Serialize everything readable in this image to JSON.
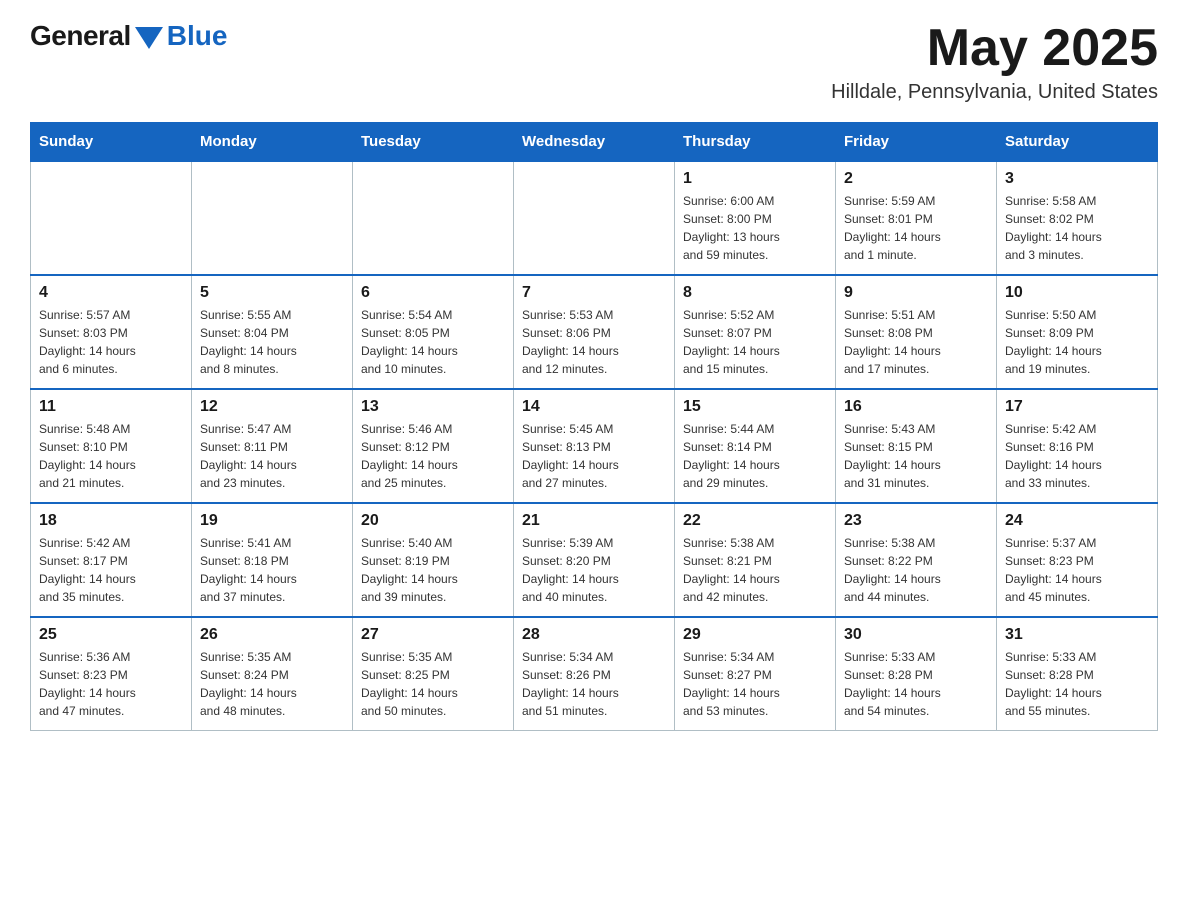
{
  "header": {
    "logo_general": "General",
    "logo_blue": "Blue",
    "month_title": "May 2025",
    "location": "Hilldale, Pennsylvania, United States"
  },
  "calendar": {
    "days_of_week": [
      "Sunday",
      "Monday",
      "Tuesday",
      "Wednesday",
      "Thursday",
      "Friday",
      "Saturday"
    ],
    "weeks": [
      [
        {
          "day": "",
          "info": ""
        },
        {
          "day": "",
          "info": ""
        },
        {
          "day": "",
          "info": ""
        },
        {
          "day": "",
          "info": ""
        },
        {
          "day": "1",
          "info": "Sunrise: 6:00 AM\nSunset: 8:00 PM\nDaylight: 13 hours\nand 59 minutes."
        },
        {
          "day": "2",
          "info": "Sunrise: 5:59 AM\nSunset: 8:01 PM\nDaylight: 14 hours\nand 1 minute."
        },
        {
          "day": "3",
          "info": "Sunrise: 5:58 AM\nSunset: 8:02 PM\nDaylight: 14 hours\nand 3 minutes."
        }
      ],
      [
        {
          "day": "4",
          "info": "Sunrise: 5:57 AM\nSunset: 8:03 PM\nDaylight: 14 hours\nand 6 minutes."
        },
        {
          "day": "5",
          "info": "Sunrise: 5:55 AM\nSunset: 8:04 PM\nDaylight: 14 hours\nand 8 minutes."
        },
        {
          "day": "6",
          "info": "Sunrise: 5:54 AM\nSunset: 8:05 PM\nDaylight: 14 hours\nand 10 minutes."
        },
        {
          "day": "7",
          "info": "Sunrise: 5:53 AM\nSunset: 8:06 PM\nDaylight: 14 hours\nand 12 minutes."
        },
        {
          "day": "8",
          "info": "Sunrise: 5:52 AM\nSunset: 8:07 PM\nDaylight: 14 hours\nand 15 minutes."
        },
        {
          "day": "9",
          "info": "Sunrise: 5:51 AM\nSunset: 8:08 PM\nDaylight: 14 hours\nand 17 minutes."
        },
        {
          "day": "10",
          "info": "Sunrise: 5:50 AM\nSunset: 8:09 PM\nDaylight: 14 hours\nand 19 minutes."
        }
      ],
      [
        {
          "day": "11",
          "info": "Sunrise: 5:48 AM\nSunset: 8:10 PM\nDaylight: 14 hours\nand 21 minutes."
        },
        {
          "day": "12",
          "info": "Sunrise: 5:47 AM\nSunset: 8:11 PM\nDaylight: 14 hours\nand 23 minutes."
        },
        {
          "day": "13",
          "info": "Sunrise: 5:46 AM\nSunset: 8:12 PM\nDaylight: 14 hours\nand 25 minutes."
        },
        {
          "day": "14",
          "info": "Sunrise: 5:45 AM\nSunset: 8:13 PM\nDaylight: 14 hours\nand 27 minutes."
        },
        {
          "day": "15",
          "info": "Sunrise: 5:44 AM\nSunset: 8:14 PM\nDaylight: 14 hours\nand 29 minutes."
        },
        {
          "day": "16",
          "info": "Sunrise: 5:43 AM\nSunset: 8:15 PM\nDaylight: 14 hours\nand 31 minutes."
        },
        {
          "day": "17",
          "info": "Sunrise: 5:42 AM\nSunset: 8:16 PM\nDaylight: 14 hours\nand 33 minutes."
        }
      ],
      [
        {
          "day": "18",
          "info": "Sunrise: 5:42 AM\nSunset: 8:17 PM\nDaylight: 14 hours\nand 35 minutes."
        },
        {
          "day": "19",
          "info": "Sunrise: 5:41 AM\nSunset: 8:18 PM\nDaylight: 14 hours\nand 37 minutes."
        },
        {
          "day": "20",
          "info": "Sunrise: 5:40 AM\nSunset: 8:19 PM\nDaylight: 14 hours\nand 39 minutes."
        },
        {
          "day": "21",
          "info": "Sunrise: 5:39 AM\nSunset: 8:20 PM\nDaylight: 14 hours\nand 40 minutes."
        },
        {
          "day": "22",
          "info": "Sunrise: 5:38 AM\nSunset: 8:21 PM\nDaylight: 14 hours\nand 42 minutes."
        },
        {
          "day": "23",
          "info": "Sunrise: 5:38 AM\nSunset: 8:22 PM\nDaylight: 14 hours\nand 44 minutes."
        },
        {
          "day": "24",
          "info": "Sunrise: 5:37 AM\nSunset: 8:23 PM\nDaylight: 14 hours\nand 45 minutes."
        }
      ],
      [
        {
          "day": "25",
          "info": "Sunrise: 5:36 AM\nSunset: 8:23 PM\nDaylight: 14 hours\nand 47 minutes."
        },
        {
          "day": "26",
          "info": "Sunrise: 5:35 AM\nSunset: 8:24 PM\nDaylight: 14 hours\nand 48 minutes."
        },
        {
          "day": "27",
          "info": "Sunrise: 5:35 AM\nSunset: 8:25 PM\nDaylight: 14 hours\nand 50 minutes."
        },
        {
          "day": "28",
          "info": "Sunrise: 5:34 AM\nSunset: 8:26 PM\nDaylight: 14 hours\nand 51 minutes."
        },
        {
          "day": "29",
          "info": "Sunrise: 5:34 AM\nSunset: 8:27 PM\nDaylight: 14 hours\nand 53 minutes."
        },
        {
          "day": "30",
          "info": "Sunrise: 5:33 AM\nSunset: 8:28 PM\nDaylight: 14 hours\nand 54 minutes."
        },
        {
          "day": "31",
          "info": "Sunrise: 5:33 AM\nSunset: 8:28 PM\nDaylight: 14 hours\nand 55 minutes."
        }
      ]
    ]
  }
}
